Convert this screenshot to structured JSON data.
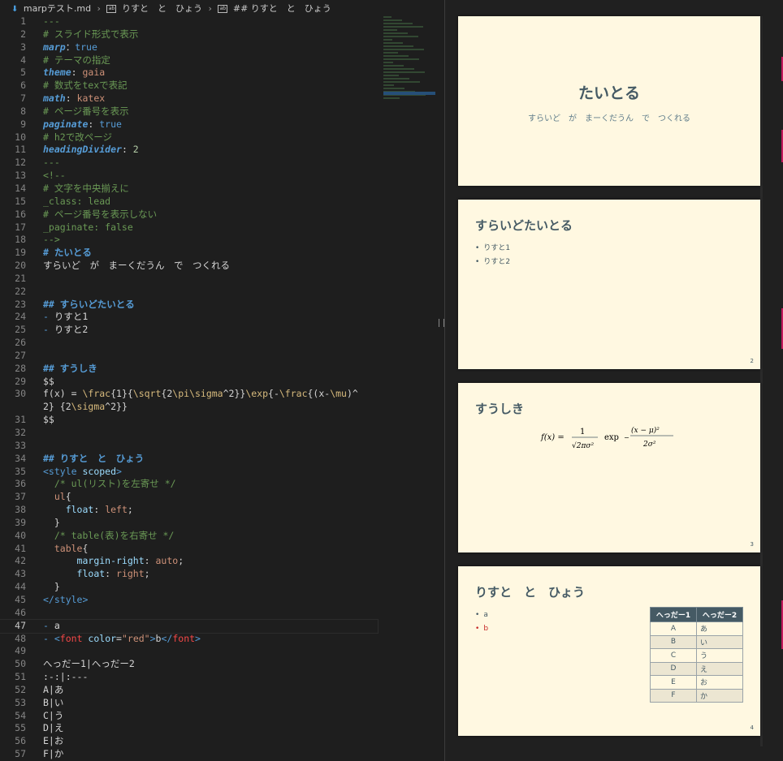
{
  "breadcrumb": {
    "file": "marpテスト.md",
    "h1": "りすと　と　ひょう",
    "h2": "## りすと　と　ひょう"
  },
  "lines": [
    {
      "n": "1",
      "parts": [
        [
          "c-com",
          "---"
        ]
      ]
    },
    {
      "n": "2",
      "parts": [
        [
          "c-com",
          "# スライド形式で表示"
        ]
      ]
    },
    {
      "n": "3",
      "parts": [
        [
          "c-key",
          "marp"
        ],
        [
          "",
          "："
        ],
        [
          "c-kw",
          "true"
        ]
      ]
    },
    {
      "n": "4",
      "parts": [
        [
          "c-com",
          "# テーマの指定"
        ]
      ]
    },
    {
      "n": "5",
      "parts": [
        [
          "c-key",
          "theme"
        ],
        [
          "",
          ": "
        ],
        [
          "c-val",
          "gaia"
        ]
      ]
    },
    {
      "n": "6",
      "parts": [
        [
          "c-com",
          "# 数式をtexで表記"
        ]
      ]
    },
    {
      "n": "7",
      "parts": [
        [
          "c-key",
          "math"
        ],
        [
          "",
          ": "
        ],
        [
          "c-val",
          "katex"
        ]
      ]
    },
    {
      "n": "8",
      "parts": [
        [
          "c-com",
          "# ページ番号を表示"
        ]
      ]
    },
    {
      "n": "9",
      "parts": [
        [
          "c-key",
          "paginate"
        ],
        [
          "",
          ": "
        ],
        [
          "c-kw",
          "true"
        ]
      ]
    },
    {
      "n": "10",
      "parts": [
        [
          "c-com",
          "# h2で改ページ"
        ]
      ]
    },
    {
      "n": "11",
      "parts": [
        [
          "c-key",
          "headingDivider"
        ],
        [
          "",
          ": "
        ],
        [
          "c-num",
          "2"
        ]
      ]
    },
    {
      "n": "12",
      "parts": [
        [
          "c-com",
          "---"
        ]
      ]
    },
    {
      "n": "13",
      "parts": [
        [
          "c-com",
          "<!--"
        ]
      ]
    },
    {
      "n": "14",
      "parts": [
        [
          "c-com",
          "# 文字を中央揃えに"
        ]
      ]
    },
    {
      "n": "15",
      "parts": [
        [
          "c-com",
          "_class: lead"
        ]
      ]
    },
    {
      "n": "16",
      "parts": [
        [
          "c-com",
          "# ページ番号を表示しない"
        ]
      ]
    },
    {
      "n": "17",
      "parts": [
        [
          "c-com",
          "_paginate: false"
        ]
      ]
    },
    {
      "n": "18",
      "parts": [
        [
          "c-com",
          "-->"
        ]
      ]
    },
    {
      "n": "19",
      "parts": [
        [
          "c-h",
          "# たいとる"
        ]
      ]
    },
    {
      "n": "20",
      "parts": [
        [
          "",
          "すらいど　が　まーくだうん　で　つくれる"
        ]
      ]
    },
    {
      "n": "21",
      "parts": []
    },
    {
      "n": "22",
      "parts": []
    },
    {
      "n": "23",
      "parts": [
        [
          "c-h",
          "## すらいどたいとる"
        ]
      ]
    },
    {
      "n": "24",
      "parts": [
        [
          "c-kw",
          "- "
        ],
        [
          "",
          "りすと1"
        ]
      ]
    },
    {
      "n": "25",
      "parts": [
        [
          "c-kw",
          "- "
        ],
        [
          "",
          "りすと2"
        ]
      ]
    },
    {
      "n": "26",
      "parts": []
    },
    {
      "n": "27",
      "parts": []
    },
    {
      "n": "28",
      "parts": [
        [
          "c-h",
          "## すうしき"
        ]
      ]
    },
    {
      "n": "29",
      "parts": [
        [
          "",
          "$$"
        ]
      ]
    },
    {
      "n": "30",
      "tall": true,
      "parts": [
        [
          "",
          "f(x) = "
        ],
        [
          "c-esc",
          "\\frac"
        ],
        [
          "",
          "{1}{"
        ],
        [
          "c-esc",
          "\\sqrt"
        ],
        [
          "",
          "{2"
        ],
        [
          "c-esc",
          "\\pi"
        ],
        [
          "c-esc",
          "\\sigma"
        ],
        [
          "",
          "^2}}"
        ],
        [
          "c-esc",
          "\\exp"
        ],
        [
          "",
          "{-"
        ],
        [
          "c-esc",
          "\\frac"
        ],
        [
          "",
          "{(x-"
        ],
        [
          "c-esc",
          "\\mu"
        ],
        [
          "",
          ")^2} {2"
        ],
        [
          "c-esc",
          "\\sigma"
        ],
        [
          "",
          "^2}}"
        ]
      ]
    },
    {
      "n": "31",
      "parts": [
        [
          "",
          "$$"
        ]
      ]
    },
    {
      "n": "32",
      "parts": []
    },
    {
      "n": "33",
      "parts": []
    },
    {
      "n": "34",
      "parts": [
        [
          "c-h",
          "## りすと　と　ひょう"
        ]
      ]
    },
    {
      "n": "35",
      "parts": [
        [
          "c-tag",
          "<style "
        ],
        [
          "c-prop",
          "scoped"
        ],
        [
          "c-tag",
          ">"
        ]
      ]
    },
    {
      "n": "36",
      "parts": [
        [
          "c-com",
          "  /* ul(リスト)を左寄せ */"
        ]
      ]
    },
    {
      "n": "37",
      "parts": [
        [
          "c-val",
          "  ul"
        ],
        [
          "",
          "{"
        ]
      ]
    },
    {
      "n": "38",
      "parts": [
        [
          "",
          "    "
        ],
        [
          "c-prop",
          "float"
        ],
        [
          "",
          ": "
        ],
        [
          "c-val",
          "left"
        ],
        [
          "",
          ";"
        ]
      ]
    },
    {
      "n": "39",
      "parts": [
        [
          "",
          "  }"
        ]
      ]
    },
    {
      "n": "40",
      "parts": [
        [
          "c-com",
          "  /* table(表)を右寄せ */"
        ]
      ]
    },
    {
      "n": "41",
      "parts": [
        [
          "c-val",
          "  table"
        ],
        [
          "",
          "{"
        ]
      ]
    },
    {
      "n": "42",
      "parts": [
        [
          "",
          "      "
        ],
        [
          "c-prop",
          "margin-right"
        ],
        [
          "",
          ": "
        ],
        [
          "c-val",
          "auto"
        ],
        [
          "",
          ";"
        ]
      ]
    },
    {
      "n": "43",
      "parts": [
        [
          "",
          "      "
        ],
        [
          "c-prop",
          "float"
        ],
        [
          "",
          ": "
        ],
        [
          "c-val",
          "right"
        ],
        [
          "",
          ";"
        ]
      ]
    },
    {
      "n": "44",
      "parts": [
        [
          "",
          "  }"
        ]
      ]
    },
    {
      "n": "45",
      "parts": [
        [
          "c-tag",
          "</style>"
        ]
      ]
    },
    {
      "n": "46",
      "parts": []
    },
    {
      "n": "47",
      "cur": true,
      "parts": [
        [
          "c-kw",
          "- "
        ],
        [
          "",
          "a"
        ]
      ]
    },
    {
      "n": "48",
      "parts": [
        [
          "c-kw",
          "- "
        ],
        [
          "c-tag",
          "<"
        ],
        [
          "c-red",
          "font "
        ],
        [
          "c-prop",
          "color"
        ],
        [
          "",
          "="
        ],
        [
          "c-val",
          "\"red\""
        ],
        [
          "c-tag",
          ">"
        ],
        [
          "",
          "b"
        ],
        [
          "c-tag",
          "</"
        ],
        [
          "c-red",
          "font"
        ],
        [
          "c-tag",
          ">"
        ]
      ]
    },
    {
      "n": "49",
      "parts": []
    },
    {
      "n": "50",
      "parts": [
        [
          "",
          "へっだー1|へっだー2"
        ]
      ]
    },
    {
      "n": "51",
      "parts": [
        [
          "",
          ":-:|:---"
        ]
      ]
    },
    {
      "n": "52",
      "parts": [
        [
          "",
          "A|あ"
        ]
      ]
    },
    {
      "n": "53",
      "parts": [
        [
          "",
          "B|い"
        ]
      ]
    },
    {
      "n": "54",
      "parts": [
        [
          "",
          "C|う"
        ]
      ]
    },
    {
      "n": "55",
      "parts": [
        [
          "",
          "D|え"
        ]
      ]
    },
    {
      "n": "56",
      "parts": [
        [
          "",
          "E|お"
        ]
      ]
    },
    {
      "n": "57",
      "parts": [
        [
          "",
          "F|か"
        ]
      ]
    }
  ],
  "slides": {
    "s1": {
      "title": "たいとる",
      "subtitle": "すらいど　が　まーくだうん　で　つくれる"
    },
    "s2": {
      "title": "すらいどたいとる",
      "items": [
        "りすと1",
        "りすと2"
      ],
      "page": "2"
    },
    "s3": {
      "title": "すうしき",
      "page": "3",
      "f_lhs": "f(x) =",
      "f_num": "1",
      "f_den": "√2πσ²",
      "f_exp": "exp",
      "f_enum": "(x − μ)²",
      "f_eden": "2σ²",
      "f_minus": "−"
    },
    "s4": {
      "title": "りすと　と　ひょう",
      "items": [
        "a",
        "b"
      ],
      "page": "4",
      "headers": [
        "へっだー1",
        "へっだー2"
      ],
      "rows": [
        [
          "A",
          "あ"
        ],
        [
          "B",
          "い"
        ],
        [
          "C",
          "う"
        ],
        [
          "D",
          "え"
        ],
        [
          "E",
          "お"
        ],
        [
          "F",
          "か"
        ]
      ]
    }
  },
  "colors": {
    "accent_red": "#c62828"
  }
}
